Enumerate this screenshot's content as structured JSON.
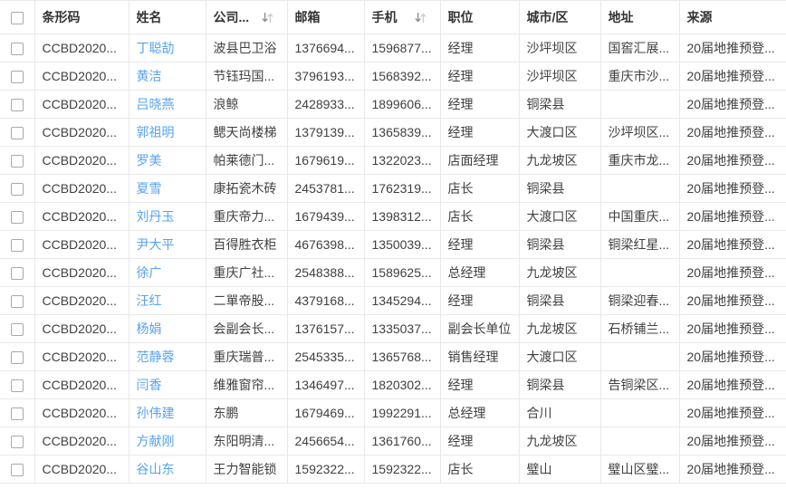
{
  "table": {
    "columns": [
      {
        "key": "select",
        "label": "",
        "type": "checkbox"
      },
      {
        "key": "barcode",
        "label": "条形码"
      },
      {
        "key": "name",
        "label": "姓名",
        "link": true
      },
      {
        "key": "company",
        "label": "公司...",
        "sortable": true
      },
      {
        "key": "email",
        "label": "邮箱"
      },
      {
        "key": "phone",
        "label": "手机",
        "sortable": true
      },
      {
        "key": "position",
        "label": "职位"
      },
      {
        "key": "city",
        "label": "城市/区"
      },
      {
        "key": "address",
        "label": "地址"
      },
      {
        "key": "source",
        "label": "来源"
      }
    ],
    "rows": [
      {
        "barcode": "CCBD2020...",
        "name": "丁聪劼",
        "company": "波县巴卫浴",
        "email": "1376694...",
        "phone": "1596877...",
        "position": "经理",
        "city": "沙坪坝区",
        "address": "国窖汇展...",
        "source": "20届地推预登..."
      },
      {
        "barcode": "CCBD2020...",
        "name": "黄洁",
        "company": "节钰玛国...",
        "email": "3796193...",
        "phone": "1568392...",
        "position": "经理",
        "city": "沙坪坝区",
        "address": "重庆市沙...",
        "source": "20届地推预登..."
      },
      {
        "barcode": "CCBD2020...",
        "name": "吕晓燕",
        "company": "浪鲸",
        "email": "2428933...",
        "phone": "1899606...",
        "position": "经理",
        "city": "铜梁县",
        "address": "",
        "source": "20届地推预登..."
      },
      {
        "barcode": "CCBD2020...",
        "name": "郭祖明",
        "company": "鳃天尚楼梯",
        "email": "1379139...",
        "phone": "1365839...",
        "position": "经理",
        "city": "大渡口区",
        "address": "沙坪坝区...",
        "source": "20届地推预登..."
      },
      {
        "barcode": "CCBD2020...",
        "name": "罗美",
        "company": "帕莱德门...",
        "email": "1679619...",
        "phone": "1322023...",
        "position": "店面经理",
        "city": "九龙坡区",
        "address": "重庆市龙...",
        "source": "20届地推预登..."
      },
      {
        "barcode": "CCBD2020...",
        "name": "夏雪",
        "company": "康拓瓷木砖",
        "email": "2453781...",
        "phone": "1762319...",
        "position": "店长",
        "city": "铜梁县",
        "address": "",
        "source": "20届地推预登..."
      },
      {
        "barcode": "CCBD2020...",
        "name": "刘丹玉",
        "company": "重庆帝力...",
        "email": "1679439...",
        "phone": "1398312...",
        "position": "店长",
        "city": "大渡口区",
        "address": "中国重庆...",
        "source": "20届地推预登..."
      },
      {
        "barcode": "CCBD2020...",
        "name": "尹大平",
        "company": "百得胜衣柜",
        "email": "4676398...",
        "phone": "1350039...",
        "position": "经理",
        "city": "铜梁县",
        "address": "铜梁红星...",
        "source": "20届地推预登..."
      },
      {
        "barcode": "CCBD2020...",
        "name": "徐广",
        "company": "重庆广社...",
        "email": "2548388...",
        "phone": "1589625...",
        "position": "总经理",
        "city": "九龙坡区",
        "address": "",
        "source": "20届地推预登..."
      },
      {
        "barcode": "CCBD2020...",
        "name": "汪红",
        "company": "二單帝股...",
        "email": "4379168...",
        "phone": "1345294...",
        "position": "经理",
        "city": "铜梁县",
        "address": "铜梁迎春...",
        "source": "20届地推预登..."
      },
      {
        "barcode": "CCBD2020...",
        "name": "杨娟",
        "company": "会副会长...",
        "email": "1376157...",
        "phone": "1335037...",
        "position": "副会长单位",
        "city": "九龙坡区",
        "address": "石桥铺兰...",
        "source": "20届地推预登..."
      },
      {
        "barcode": "CCBD2020...",
        "name": "范静蓉",
        "company": "重庆瑞普...",
        "email": "2545335...",
        "phone": "1365768...",
        "position": "销售经理",
        "city": "大渡口区",
        "address": "",
        "source": "20届地推预登..."
      },
      {
        "barcode": "CCBD2020...",
        "name": "闫香",
        "company": "维雅窗帘...",
        "email": "1346497...",
        "phone": "1820302...",
        "position": "经理",
        "city": "铜梁县",
        "address": "告铜梁区...",
        "source": "20届地推预登..."
      },
      {
        "barcode": "CCBD2020...",
        "name": "孙伟建",
        "company": "东鹏",
        "email": "1679469...",
        "phone": "1992291...",
        "position": "总经理",
        "city": "合川",
        "address": "",
        "source": "20届地推预登..."
      },
      {
        "barcode": "CCBD2020...",
        "name": "方献刚",
        "company": "东阳明清...",
        "email": "2456654...",
        "phone": "1361760...",
        "position": "经理",
        "city": "九龙坡区",
        "address": "",
        "source": "20届地推预登..."
      },
      {
        "barcode": "CCBD2020...",
        "name": "谷山东",
        "company": "王力智能锁",
        "email": "1592322...",
        "phone": "1592322...",
        "position": "店长",
        "city": "璧山",
        "address": "璧山区璧...",
        "source": "20届地推预登..."
      }
    ]
  },
  "icons": {
    "sort": "sort-arrows-icon",
    "checkbox": "checkbox"
  },
  "colors": {
    "link_blue": "#57a3f3",
    "border": "#e9e9e9",
    "header_text": "#333333",
    "cell_text": "#404040",
    "sort_arrow_dark": "#8f8f8f",
    "sort_arrow_light": "#cdcdcd"
  }
}
